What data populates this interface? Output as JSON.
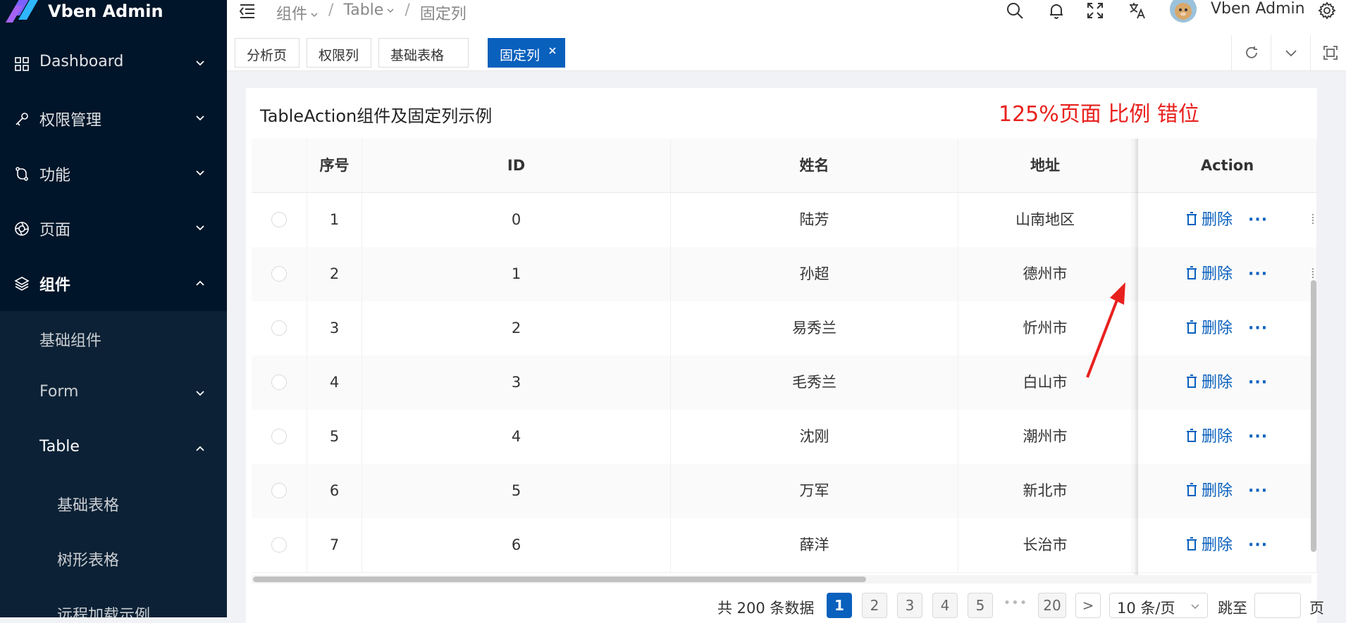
{
  "app": {
    "logo_text": "Vben Admin"
  },
  "sidebar": {
    "items": [
      {
        "label": "Dashboard",
        "icon": "grid-icon"
      },
      {
        "label": "权限管理",
        "icon": "key-icon"
      },
      {
        "label": "功能",
        "icon": "branch-icon"
      },
      {
        "label": "页面",
        "icon": "aperture-icon"
      },
      {
        "label": "组件",
        "icon": "layers-icon"
      }
    ],
    "sub_items": [
      {
        "label": "基础组件"
      },
      {
        "label": "Form"
      },
      {
        "label": "Table"
      },
      {
        "label": "基础表格"
      },
      {
        "label": "树形表格"
      },
      {
        "label": "远程加载示例"
      }
    ]
  },
  "header": {
    "breadcrumb": [
      "组件",
      "Table",
      "固定列"
    ],
    "username": "Vben Admin"
  },
  "tabs": [
    {
      "label": "分析页"
    },
    {
      "label": "权限列"
    },
    {
      "label": "基础表格"
    },
    {
      "label": "固定列"
    }
  ],
  "card": {
    "title": "TableAction组件及固定列示例",
    "annotation": "125%页面 比例  错位"
  },
  "table": {
    "columns": [
      "序号",
      "ID",
      "姓名",
      "地址",
      "Action"
    ],
    "rows": [
      {
        "no": "1",
        "id": "0",
        "name": "陆芳",
        "address": "山南地区"
      },
      {
        "no": "2",
        "id": "1",
        "name": "孙超",
        "address": "德州市"
      },
      {
        "no": "3",
        "id": "2",
        "name": "易秀兰",
        "address": "忻州市"
      },
      {
        "no": "4",
        "id": "3",
        "name": "毛秀兰",
        "address": "白山市"
      },
      {
        "no": "5",
        "id": "4",
        "name": "沈刚",
        "address": "潮州市"
      },
      {
        "no": "6",
        "id": "5",
        "name": "万军",
        "address": "新北市"
      },
      {
        "no": "7",
        "id": "6",
        "name": "薛洋",
        "address": "长治市"
      }
    ],
    "delete_label": "删除",
    "more_label": "···"
  },
  "pagination": {
    "total_text": "共 200 条数据",
    "pages": [
      "1",
      "2",
      "3",
      "4",
      "5"
    ],
    "dots": "•••",
    "last_page": "20",
    "next": ">",
    "page_size": "10 条/页",
    "jump_label": "跳至",
    "jump_suffix": "页"
  },
  "colors": {
    "primary": "#0960bd",
    "sidebar_bg": "#001529",
    "annotation": "#e8211e"
  }
}
